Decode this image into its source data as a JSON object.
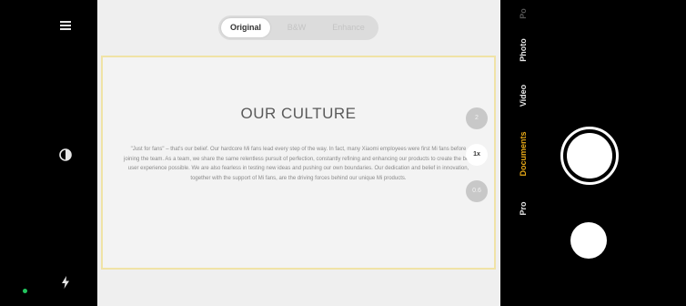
{
  "colors": {
    "accent": "#e6a817",
    "status_dot": "#22c55e",
    "frame_border": "#f0e3a6"
  },
  "left_bar": {
    "icons": [
      "menu-icon",
      "contrast-icon",
      "flash-auto-icon"
    ]
  },
  "filter_tabs": [
    {
      "label": "Original",
      "active": true
    },
    {
      "label": "B&W",
      "active": false
    },
    {
      "label": "Enhance",
      "active": false
    }
  ],
  "document": {
    "title": "OUR CULTURE",
    "body": "\"Just for fans\" – that's our belief. Our hardcore Mi fans lead every step of the way. In fact, many Xiaomi employees were first Mi fans before joining the team. As a team, we share the same relentless pursuit of perfection, constantly refining and enhancing our products to create the best user experience possible. We are also fearless in testing new ideas and pushing our own boundaries. Our dedication and belief in innovation, together with the support of Mi fans, are the driving forces behind our unique Mi products."
  },
  "zoom_levels": [
    {
      "label": "2",
      "active": false
    },
    {
      "label": "1x",
      "active": true
    },
    {
      "label": "0.6",
      "active": false
    }
  ],
  "modes": [
    {
      "label": "Pro",
      "active": false
    },
    {
      "label": "Documents",
      "active": true
    },
    {
      "label": "Video",
      "active": false
    },
    {
      "label": "Photo",
      "active": false
    },
    {
      "label": "Po",
      "active": false
    }
  ]
}
